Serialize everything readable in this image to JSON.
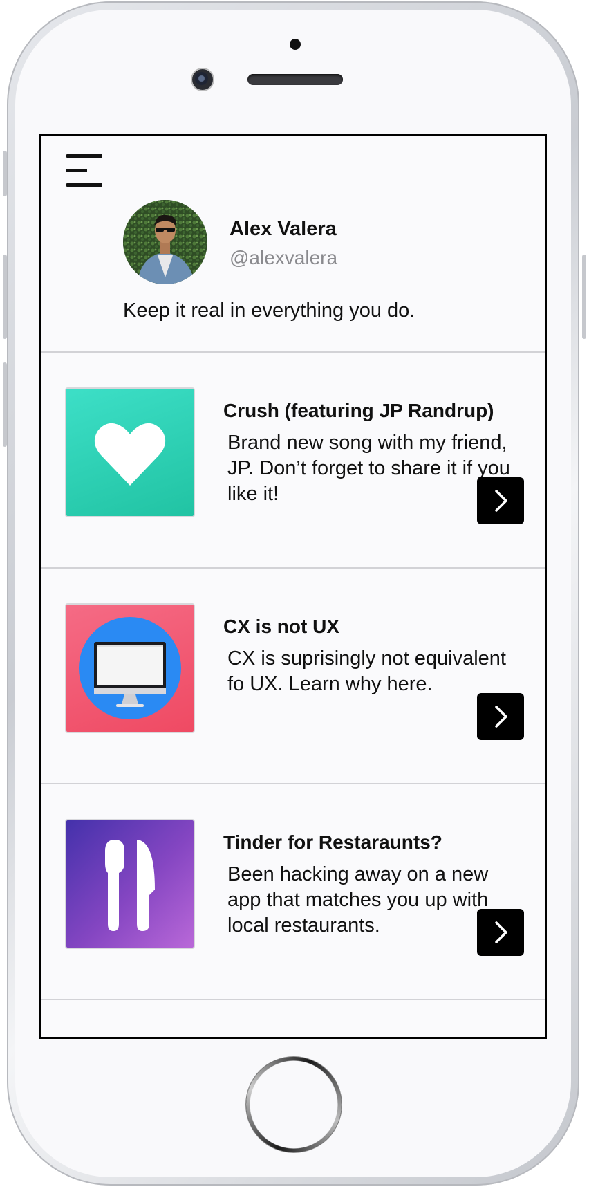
{
  "profile": {
    "name": "Alex Valera",
    "handle": "@alexvalera",
    "bio": "Keep it real in everything you do."
  },
  "posts": [
    {
      "title": "Crush (featuring JP Randrup)",
      "description": "Brand new song with my friend, JP. Don’t forget to share it if you like it!",
      "icon": "heart-icon",
      "color": "#26c6a6"
    },
    {
      "title": "CX is not UX",
      "description": "CX is suprisingly not equivalent fo UX. Learn why here.",
      "icon": "monitor-icon",
      "color": "#f25a74"
    },
    {
      "title": "Tinder for Restaraunts?",
      "description": "Been hacking away on a new app that matches you up with local restaurants.",
      "icon": "utensils-icon",
      "color": "#7e4cc8"
    }
  ],
  "icons": {
    "menu": "hamburger-menu-icon",
    "open": "chevron-right-icon"
  }
}
